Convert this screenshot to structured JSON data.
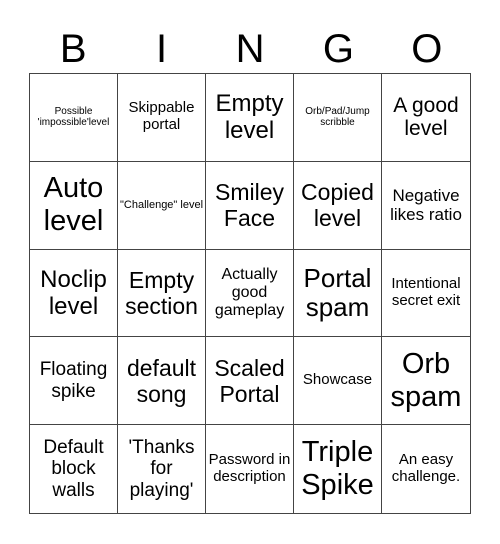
{
  "header": [
    "B",
    "I",
    "N",
    "G",
    "O"
  ],
  "cells": [
    "Possible 'impossible'level",
    "Skippable portal",
    "Empty level",
    "Orb/Pad/Jump scribble",
    "A good level",
    "Auto level",
    "\"Challenge\" level",
    "Smiley Face",
    "Copied level",
    "Negative likes ratio",
    "Noclip level",
    "Empty section",
    "Actually good gameplay",
    "Portal spam",
    "Intentional secret exit",
    "Floating spike",
    "default song",
    "Scaled Portal",
    "Showcase",
    "Orb spam",
    "Default block walls",
    "'Thanks for playing'",
    "Password in description",
    "Triple Spike",
    "An easy challenge."
  ]
}
